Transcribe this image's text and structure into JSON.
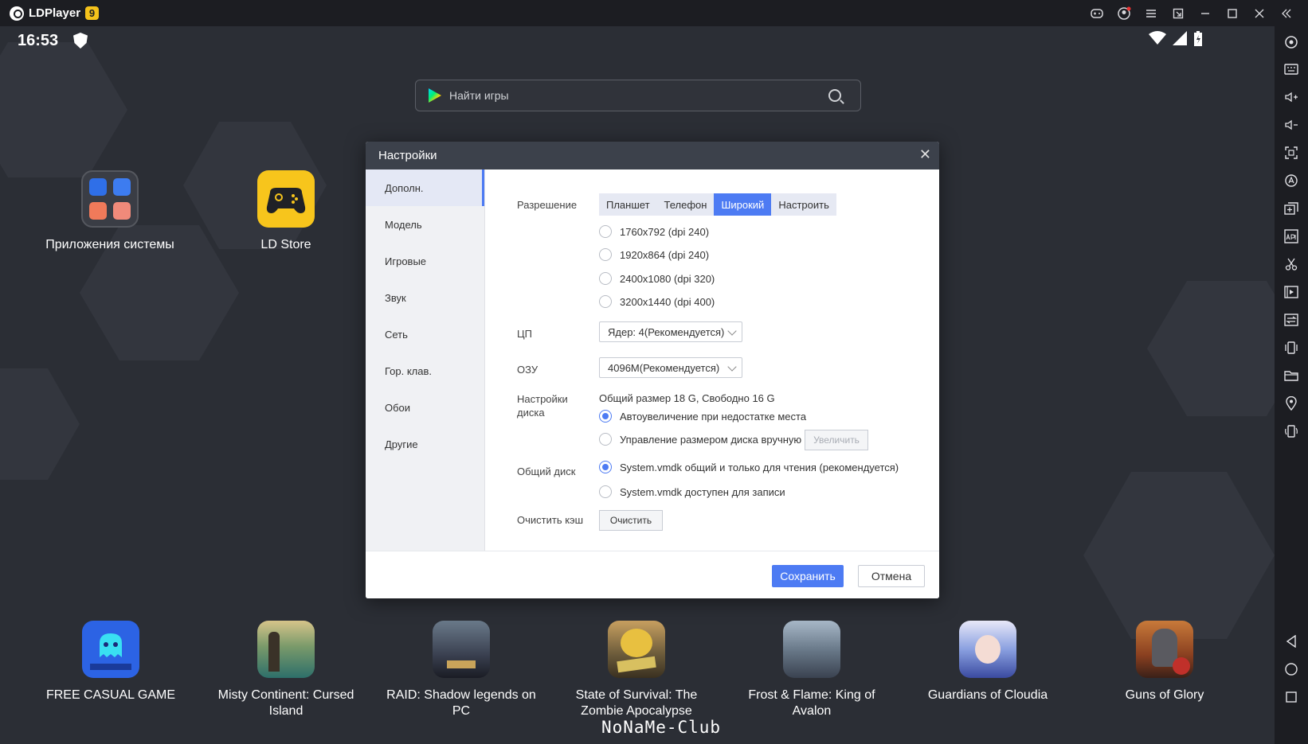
{
  "window": {
    "app_name": "LDPlayer",
    "version_badge": "9",
    "titlebar_icons": [
      "gamepad-icon",
      "account-icon",
      "menu-icon",
      "popout-icon",
      "minimize-icon",
      "maximize-icon",
      "close-icon",
      "collapse-sidebar-icon"
    ]
  },
  "status": {
    "time": "16:53"
  },
  "search": {
    "placeholder": "Найти игры"
  },
  "desktop_apps": [
    {
      "label": "Приложения системы"
    },
    {
      "label": "LD Store"
    }
  ],
  "dock_apps": [
    {
      "label": "FREE CASUAL GAME"
    },
    {
      "label": "Misty Continent: Cursed Island"
    },
    {
      "label": "RAID: Shadow legends on PC"
    },
    {
      "label": "State of Survival: The Zombie Apocalypse"
    },
    {
      "label": "Frost & Flame: King of Avalon"
    },
    {
      "label": "Guardians of Cloudia"
    },
    {
      "label": "Guns of Glory"
    }
  ],
  "settings": {
    "title": "Настройки",
    "nav": [
      "Дополн.",
      "Модель",
      "Игровые",
      "Звук",
      "Сеть",
      "Гор. клав.",
      "Обои",
      "Другие"
    ],
    "resolution_label": "Разрешение",
    "resolution_modes": [
      "Планшет",
      "Телефон",
      "Широкий",
      "Настроить"
    ],
    "resolution_active": "Широкий",
    "resolutions": [
      "1760x792  (dpi 240)",
      "1920x864  (dpi 240)",
      "2400x1080  (dpi 320)",
      "3200x1440  (dpi 400)"
    ],
    "cpu_label": "ЦП",
    "cpu_value": "Ядер: 4(Рекомендуется)",
    "ram_label": "ОЗУ",
    "ram_value": "4096M(Рекомендуется)",
    "disk_label_1": "Настройки",
    "disk_label_2": "диска",
    "disk_info": "Общий размер 18 G,  Свободно 16 G",
    "disk_auto": "Автоувеличение при недостатке места",
    "disk_manual": "Управление размером диска вручную",
    "disk_expand_button": "Увеличить",
    "shared_label": "Общий диск",
    "shared_readonly": "System.vmdk общий и только для чтения (рекомендуется)",
    "shared_writable": "System.vmdk доступен для записи",
    "cache_label": "Очистить кэш",
    "cache_button": "Очистить",
    "save_button": "Сохранить",
    "cancel_button": "Отмена"
  },
  "watermark": "NoNaMe-Club",
  "colors": {
    "accent": "#4d7bf3",
    "titlebar": "#1c1d22",
    "screen": "#2b2e35"
  }
}
